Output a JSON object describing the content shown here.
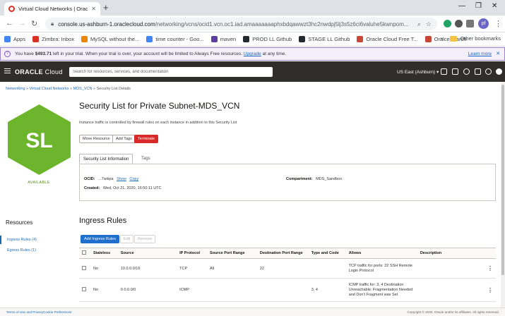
{
  "browser": {
    "tab_title": "Virtual Cloud Networks | Oracle C",
    "url_domain": "console.us-ashburn-1.oraclecloud.com",
    "url_path": "/networking/vcns/ocid1.vcn.oc1.iad.amaaaaaaaphxbdqawwzt3hc2nwdpj5lj3s5z6ci6valuhe5kwnpom...",
    "profile_initials": "pf",
    "bookmarks": [
      {
        "label": "Apps",
        "icon": "apps-grid-icon",
        "color": "#4285f4"
      },
      {
        "label": "Zimbra: Inbox",
        "icon": "zimbra-icon",
        "color": "#d93025"
      },
      {
        "label": "MySQL without the...",
        "icon": "mysql-icon",
        "color": "#ea8600"
      },
      {
        "label": "time counter - Goo...",
        "icon": "google-icon",
        "color": "#4285f4"
      },
      {
        "label": "maven",
        "icon": "maven-icon",
        "color": "#5b3fa0"
      },
      {
        "label": "PROD LL Github",
        "icon": "github-icon",
        "color": "#24292e"
      },
      {
        "label": "STAGE LL Github",
        "icon": "github-icon",
        "color": "#24292e"
      },
      {
        "label": "Oracle Cloud Free T...",
        "icon": "oracle-icon",
        "color": "#c74634"
      },
      {
        "label": "OralceSearch",
        "icon": "oracle-icon",
        "color": "#c74634"
      }
    ],
    "other_bookmarks": "Other bookmarks"
  },
  "trial_banner": {
    "prefix": "You have ",
    "amount": "$493.71",
    "middle": " left in your trial. When your trial is over, your account will be limited to Always Free resources. ",
    "upgrade": "Upgrade",
    "suffix": " at any time.",
    "learn_more": "Learn more"
  },
  "header": {
    "logo_oracle": "ORACLE",
    "logo_cloud": " Cloud",
    "search_placeholder": "Search for resources, services, and documentation",
    "region": "US East (Ashburn)"
  },
  "breadcrumb": {
    "items": [
      "Networking",
      "Virtual Cloud Networks",
      "MDS_VCN"
    ],
    "current": "Security List Details"
  },
  "resource": {
    "badge": "SL",
    "status": "AVAILABLE",
    "title": "Security List for Private Subnet-MDS_VCN",
    "description": "Instance traffic is controlled by firewall rules on each instance in addition to this Security List"
  },
  "actions": {
    "move": "Move Resource",
    "tags": "Add Tags",
    "terminate": "Terminate"
  },
  "tabs": {
    "info": "Security List Information",
    "tags": "Tags"
  },
  "info": {
    "ocid_label": "OCID:",
    "ocid_value": "...7arkpa",
    "show": "Show",
    "copy": "Copy",
    "created_label": "Created:",
    "created_value": "Wed, Oct 21, 2020, 16:50:11 UTC",
    "compartment_label": "Compartment:",
    "compartment_value": "MDS_Sandbox"
  },
  "resources_nav": {
    "title": "Resources",
    "items": [
      "Ingress Rules (4)",
      "Egress Rules (1)"
    ]
  },
  "ingress": {
    "title": "Ingress Rules",
    "add": "Add Ingress Rules",
    "edit": "Edit",
    "remove": "Remove",
    "columns": [
      "Stateless",
      "Source",
      "IP Protocol",
      "Source Port Range",
      "Destination Port Range",
      "Type and Code",
      "Allows",
      "Description"
    ],
    "rows": [
      {
        "stateless": "No",
        "source": "10.0.0.0/16",
        "protocol": "TCP",
        "src_port": "All",
        "dst_port": "22",
        "type_code": "",
        "allows": "TCP traffic for ports: 22 SSH Remote Login Protocol",
        "description": ""
      },
      {
        "stateless": "No",
        "source": "0.0.0.0/0",
        "protocol": "ICMP",
        "src_port": "",
        "dst_port": "",
        "type_code": "3, 4",
        "allows": "ICMP traffic for: 3, 4 Destination Unreachable: Fragmentation Needed and Don't Fragment was Set",
        "description": ""
      }
    ]
  },
  "footer": {
    "terms": "Terms of Use and Privacy",
    "cookies": "Cookie Preferences",
    "copyright": "Copyright © 2020, Oracle and/or its affiliates. All rights reserved."
  }
}
